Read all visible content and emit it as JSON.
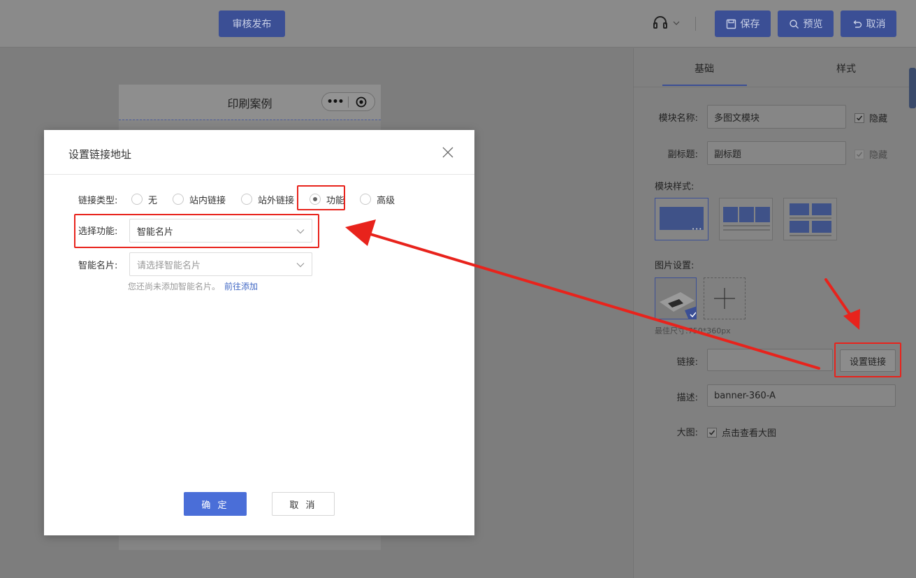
{
  "topbar": {
    "publish_label": "审核发布",
    "save_label": "保存",
    "preview_label": "预览",
    "cancel_label": "取消"
  },
  "phone": {
    "title": "印刷案例"
  },
  "panel": {
    "tabs": [
      {
        "label": "基础",
        "active": true
      },
      {
        "label": "样式",
        "active": false
      }
    ],
    "module_name_label": "模块名称:",
    "module_name_value": "多图文模块",
    "hide_label": "隐藏",
    "subtitle_label": "副标题:",
    "subtitle_value": "副标题",
    "subtitle_hide_label": "隐藏",
    "module_style_label": "模块样式:",
    "image_settings_label": "图片设置:",
    "image_size_tip": "最佳尺寸:750*360px",
    "link_label": "链接:",
    "link_value": "",
    "set_link_label": "设置链接",
    "desc_label": "描述:",
    "desc_value": "banner-360-A",
    "big_image_label": "大图:",
    "big_image_check_label": "点击查看大图"
  },
  "modal": {
    "title": "设置链接地址",
    "link_type_label": "链接类型:",
    "link_types": [
      {
        "label": "无",
        "selected": false
      },
      {
        "label": "站内链接",
        "selected": false
      },
      {
        "label": "站外链接",
        "selected": false
      },
      {
        "label": "功能",
        "selected": true
      },
      {
        "label": "高级",
        "selected": false
      }
    ],
    "select_function_label": "选择功能:",
    "select_function_value": "智能名片",
    "smart_card_label": "智能名片:",
    "smart_card_placeholder": "请选择智能名片",
    "hint_text": "您还尚未添加智能名片。",
    "hint_link": "前往添加",
    "ok_label": "确 定",
    "cancel_label": "取 消"
  },
  "colors": {
    "primary": "#4a6ed8",
    "annotation_red": "#e8231c",
    "overlay_gray": "#7f7f7f"
  }
}
